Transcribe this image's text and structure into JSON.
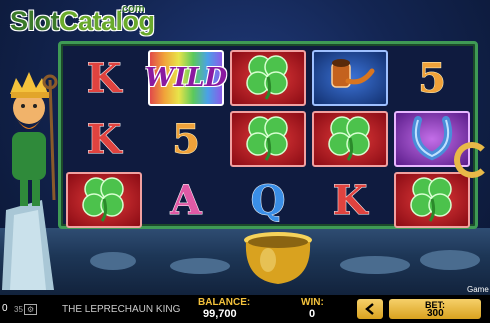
{
  "watermark": {
    "part1": "Slot",
    "part2": "Catalog",
    "suffix": ".com"
  },
  "game": {
    "title": "THE LEPRECHAUN KING",
    "balance_label": "BALANCE:",
    "balance_value": "99,700",
    "win_label": "WIN:",
    "win_value": "0",
    "bet_label": "BET:",
    "bet_value": "300",
    "game_label": "Game",
    "corner_text": "0",
    "small_text": "35"
  },
  "reels": [
    [
      {
        "symbol": "K",
        "kind": "letter",
        "color": "red",
        "bg": "none"
      },
      {
        "symbol": "K",
        "kind": "letter",
        "color": "red",
        "bg": "none"
      },
      {
        "symbol": "clover",
        "kind": "icon",
        "bg": "red"
      }
    ],
    [
      {
        "symbol": "WILD",
        "kind": "wild",
        "bg": "wild"
      },
      {
        "symbol": "5",
        "kind": "letter",
        "color": "gold",
        "bg": "none"
      },
      {
        "symbol": "A",
        "kind": "letter",
        "color": "pink",
        "bg": "none"
      }
    ],
    [
      {
        "symbol": "clover",
        "kind": "icon",
        "bg": "red"
      },
      {
        "symbol": "clover",
        "kind": "icon",
        "bg": "red"
      },
      {
        "symbol": "Q",
        "kind": "letter",
        "color": "blue",
        "bg": "none"
      }
    ],
    [
      {
        "symbol": "pipe",
        "kind": "icon",
        "bg": "blue"
      },
      {
        "symbol": "clover",
        "kind": "icon",
        "bg": "red"
      },
      {
        "symbol": "K",
        "kind": "letter",
        "color": "red",
        "bg": "none"
      }
    ],
    [
      {
        "symbol": "5",
        "kind": "letter",
        "color": "gold",
        "bg": "none"
      },
      {
        "symbol": "horseshoe",
        "kind": "icon",
        "bg": "purple"
      },
      {
        "symbol": "clover",
        "kind": "icon",
        "bg": "red"
      }
    ]
  ],
  "colors": {
    "accent": "#f4c23c",
    "frame": "#3f9a55"
  }
}
